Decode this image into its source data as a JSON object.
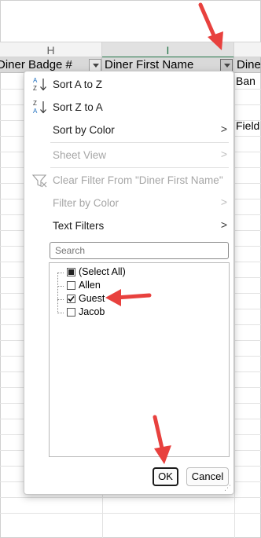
{
  "sheet": {
    "columns": [
      {
        "letter": "H"
      },
      {
        "letter": "I"
      }
    ],
    "headers": {
      "h": "Diner Badge #",
      "i": "Diner First Name",
      "j": "Dine"
    },
    "cells": {
      "j_row1": "Ban",
      "j_row3": "Field"
    }
  },
  "menu": {
    "sort_az": "Sort A to Z",
    "sort_za": "Sort Z to A",
    "sort_by_color": "Sort by Color",
    "sheet_view": "Sheet View",
    "clear_filter": "Clear Filter From \"Diner First Name\"",
    "filter_by_color": "Filter by Color",
    "text_filters": "Text Filters",
    "chevron": ">"
  },
  "search": {
    "placeholder": "Search"
  },
  "list": {
    "items": [
      {
        "label": "(Select All)",
        "state": "indeterminate"
      },
      {
        "label": "Allen",
        "state": "unchecked"
      },
      {
        "label": "Guest",
        "state": "checked"
      },
      {
        "label": "Jacob",
        "state": "unchecked"
      }
    ]
  },
  "buttons": {
    "ok": "OK",
    "cancel": "Cancel"
  },
  "annotation_color": "#e8413e"
}
